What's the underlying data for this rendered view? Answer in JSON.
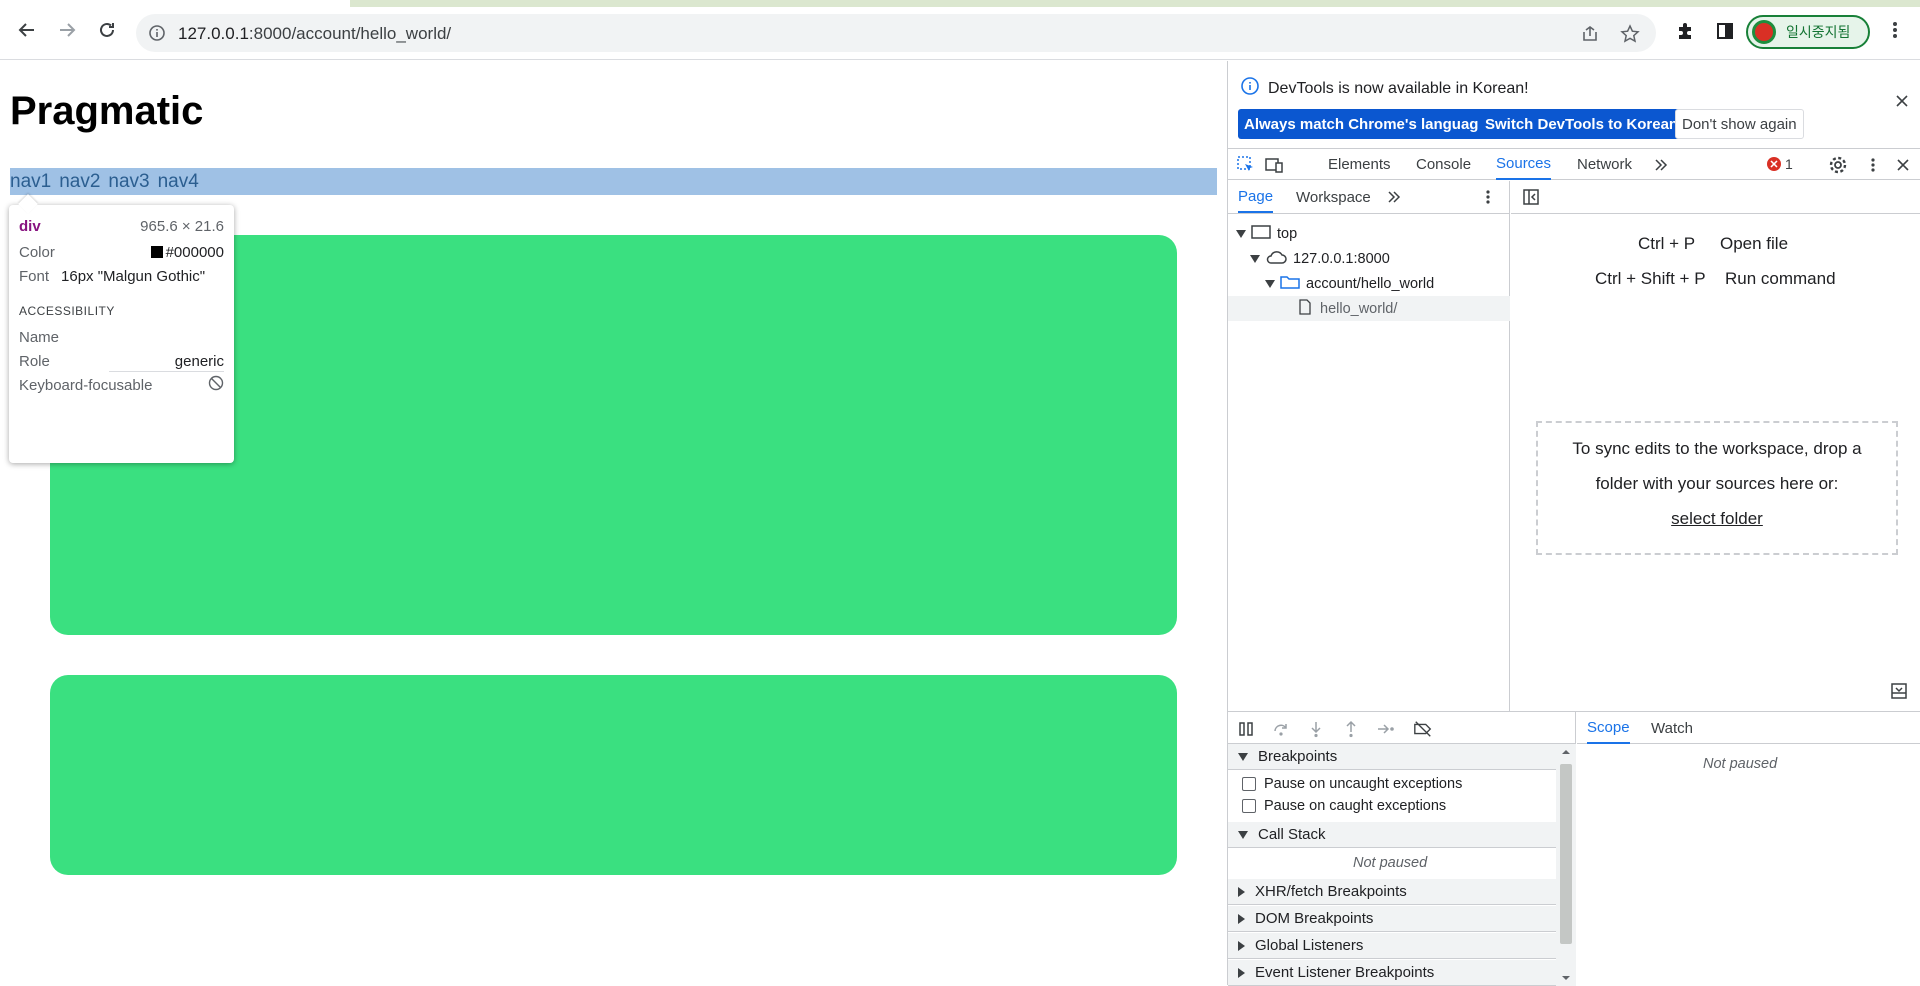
{
  "browser": {
    "url_prefix": "127.0.0.1",
    "url_rest": ":8000/account/hello_world/",
    "profile_label": "일시중지됨"
  },
  "page": {
    "title": "Pragmatic",
    "nav": [
      "nav1",
      "nav2",
      "nav3",
      "nav4"
    ],
    "tooltip": {
      "tag": "div",
      "size": "965.6 × 21.6",
      "color_label": "Color",
      "color_value": "#000000",
      "font_label": "Font",
      "font_value": "16px \"Malgun Gothic\"",
      "section": "ACCESSIBILITY",
      "name_label": "Name",
      "role_label": "Role",
      "role_value": "generic",
      "focus_label": "Keyboard-focusable"
    }
  },
  "devtools": {
    "notice": {
      "message": "DevTools is now available in Korean!",
      "btn_match": "Always match Chrome's language",
      "btn_switch": "Switch DevTools to Korean",
      "btn_dismiss": "Don't show again"
    },
    "tabs": [
      "Elements",
      "Console",
      "Sources",
      "Network"
    ],
    "active_tab": "Sources",
    "error_count": "1",
    "sub_tabs": [
      "Page",
      "Workspace"
    ],
    "tree": {
      "top": "top",
      "host": "127.0.0.1:8000",
      "folder": "account/hello_world",
      "file": "hello_world/"
    },
    "shortcuts": [
      {
        "keys": "Ctrl + P",
        "action": "Open file"
      },
      {
        "keys": "Ctrl + Shift + P",
        "action": "Run command"
      }
    ],
    "dropzone": {
      "line1": "To sync edits to the workspace, drop a",
      "line2": "folder with your sources here or:",
      "link": "select folder"
    },
    "debugger": {
      "breakpoints": "Breakpoints",
      "pause_uncaught": "Pause on uncaught exceptions",
      "pause_caught": "Pause on caught exceptions",
      "call_stack": "Call Stack",
      "not_paused": "Not paused",
      "xhr": "XHR/fetch Breakpoints",
      "dom": "DOM Breakpoints",
      "global": "Global Listeners",
      "event": "Event Listener Breakpoints",
      "scope_tab": "Scope",
      "watch_tab": "Watch",
      "scope_not_paused": "Not paused"
    }
  },
  "colors": {
    "green_box": "#3ae080",
    "highlight": "#9fc1e5",
    "accent": "#1a73e8",
    "primary_button": "#0b57d0"
  }
}
